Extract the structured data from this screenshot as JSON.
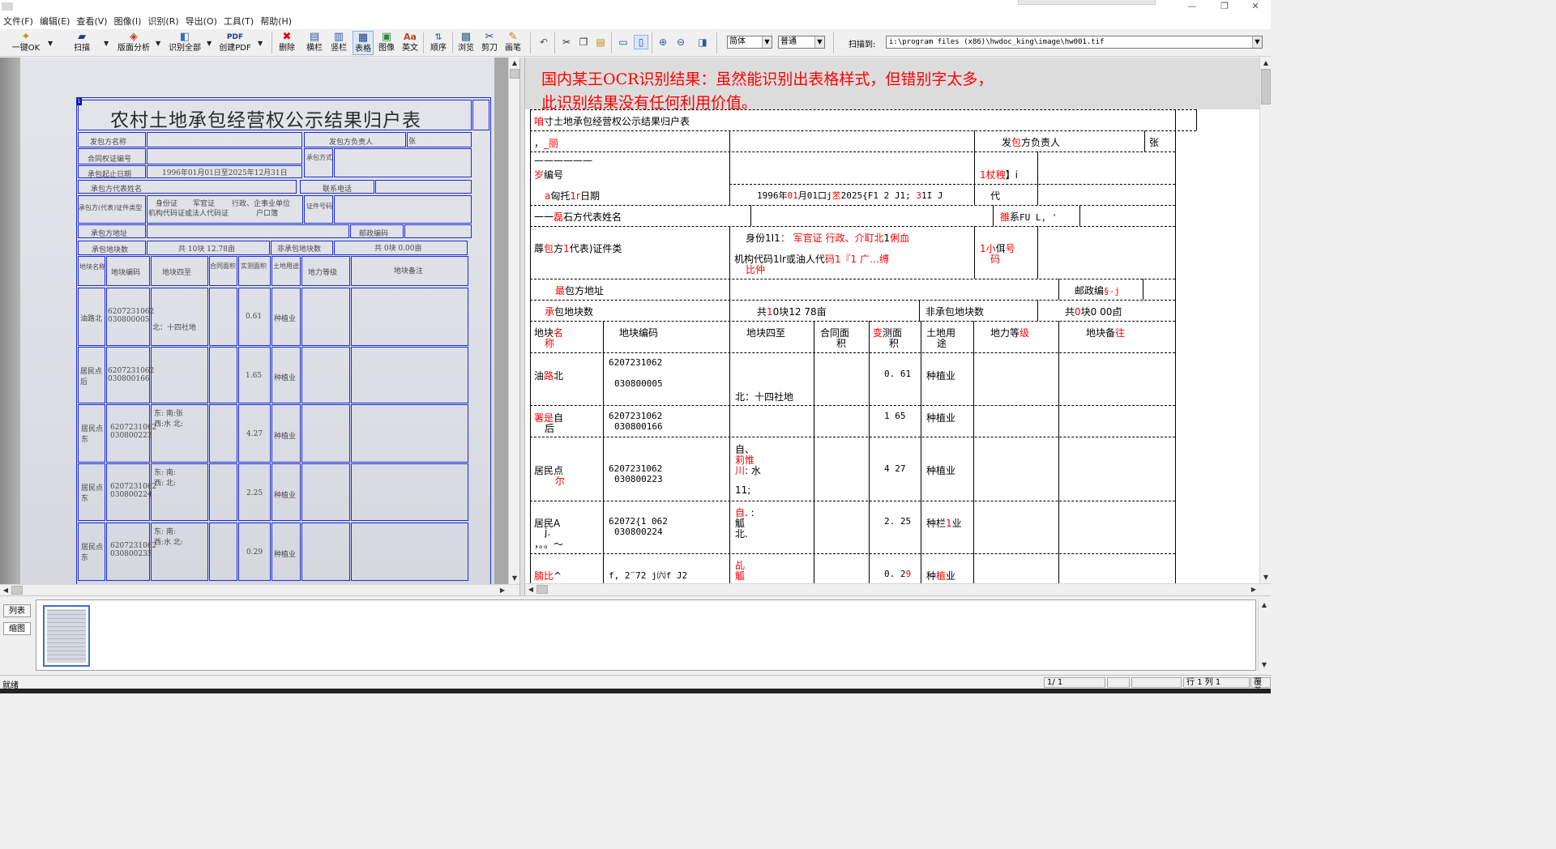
{
  "window": {
    "restore_glyph": "❐",
    "close_glyph": "✕",
    "minimize_glyph": "—"
  },
  "menu": [
    "文件(F)",
    "编辑(E)",
    "查看(V)",
    "图像(I)",
    "识别(R)",
    "导出(O)",
    "工具(T)",
    "帮助(H)"
  ],
  "toolbar": {
    "ok": "一键OK",
    "scan": "扫描",
    "layout": "版面分析",
    "recognize_all": "识别全部",
    "create_pdf": "创建PDF",
    "delete": "删除",
    "hbar": "横栏",
    "vbar": "竖栏",
    "table": "表格",
    "image": "图像",
    "english": "英文",
    "order": "顺序",
    "browse": "浏览",
    "cut": "剪刀",
    "pen": "画笔",
    "lang_value": "简体",
    "mode_value": "普通",
    "scan_to_label": "扫描到:",
    "scan_path": "i:\\program files (x86)\\hwdoc_king\\image\\hw001.tif"
  },
  "document_image": {
    "title": "农村土地承包经营权公示结果归户表",
    "rows": [
      [
        "发包方名称",
        "发包方负责人",
        "张"
      ],
      [
        "合同权证编号",
        "承包方式"
      ],
      [
        "承包起止日期",
        "1996年01月01日至2025年12月31日"
      ],
      [
        "承包方代表姓名",
        "联系电话"
      ],
      [
        "承包方(代表)证件类型",
        "身份证",
        "军官证",
        "行政、企事业单位",
        "机构代码证或法人代码证",
        "户口簿",
        "证件号码"
      ],
      [
        "承包方地址",
        "邮政编码"
      ],
      [
        "承包地块数",
        "共 10块 12.78亩",
        "非承包地块数",
        "共 0块 0.00亩"
      ]
    ],
    "headers": [
      "地块名称",
      "地块编码",
      "地块四至",
      "合同面积",
      "实测面积",
      "土地用途",
      "地力等级",
      "地块备注"
    ],
    "parcels": [
      [
        "油路北",
        "6207231062 030800005",
        "北：十四社地",
        "0.61",
        "种植业"
      ],
      [
        "居民点后",
        "6207231062 030800166",
        "",
        "1.65",
        "种植业"
      ],
      [
        "居民点东",
        "6207231062 030800223",
        "东: 南:张 西:水 北:",
        "4.27",
        "种植业"
      ],
      [
        "居民点东",
        "6207231062 030800224",
        "东: 南: 西: 北:",
        "2.25",
        "种植业"
      ],
      [
        "居民点东",
        "6207231062 030800235",
        "东: 南: 西:水 北:",
        "0.29",
        "种植业"
      ]
    ]
  },
  "ocr_result": {
    "note_line1": "国内某王OCR识别结果：虽然能识别出表格样式，但错别字太多，",
    "note_line2": "此识别结果没有任何利用价值。",
    "title_red": "咱",
    "title_rest": "寸土地承包经营权公示结果归户表",
    "r1a_b": "，",
    "r1a_r": "_丽",
    "r1b_b": "发",
    "r1b_r": "包",
    "r1b_c": "方负责人",
    "r1c": "张",
    "r2a_b": "——————",
    "r2b_r": "岁",
    "r2b_b": "编号",
    "r2c_r": "1杖䄿",
    "r2c_b": "】i",
    "r3a_r": "a",
    "r3a_b1": "匈托",
    "r3a_r2": "1r",
    "r3a_b2": "日期",
    "r3b_1": "1996年",
    "r3b_2": "01",
    "r3b_3": "月01口j",
    "r3b_4": "苤",
    "r3b_5": "2025{F1 2 J1; ",
    "r3b_6": "3",
    "r3b_7": "1I J",
    "r3c": "代",
    "r4a_b": "一一",
    "r4a_r": "磊",
    "r4a_c": "石方代表姓名",
    "r4b_r": "雒",
    "r4b_b": "系",
    "r4b_c": "FU L,  '",
    "r5a_b1": "蓐",
    "r5a_r": "包",
    "r5a_b2": "方",
    "r5a_r2": "1",
    "r5a_b3": "代表)证件类",
    "r5b_1": "身份1I1",
    "r5b_r1": "：  军官证  行政、介耵北",
    "r5b_2": "1",
    "r5b_r2": "俐血",
    "r5c_1": "机构代码1lr或油人代",
    "r5c_r1": "码1『1   广…缚",
    "r5d_r": "比仲",
    "r5e_r1": "1小",
    "r5e_b": "佴",
    "r5e_r2": "号",
    "r5f_r": "码",
    "r6a_r": "最",
    "r6a_b": "包方地址",
    "r6b_b": "邮政编",
    "r6b_r": "§-j",
    "r7a_r": "承",
    "r7a_b": "包地块数",
    "r7b_1": "共",
    "r7b_r": "1",
    "r7b_2": "0块12 78亩",
    "r7c": "非承包地块数",
    "r7d_1": "共",
    "r7d_r": "0",
    "r7d_2": "块0 00卣",
    "h1_b": "地块",
    "h1_r": "名",
    "h1_r2": "称",
    "h2": "地块编码",
    "h3": "地块四至",
    "h4a": "合同面",
    "h4b": "积",
    "h5_r": "变",
    "h5_b": "测面",
    "h5_b2": "积",
    "h6a": "土地用",
    "h6b": "途",
    "h7_b": "地力等",
    "h7_r": "级",
    "h8_b": "地块备",
    "h8_r": "往",
    "p1a_b": "油",
    "p1a_r": "路",
    "p1a_b2": "北",
    "p1b1": "6207231062",
    "p1b2": "030800005",
    "p1c": "北：十四社地",
    "p1d": "0. 61",
    "p1e": "种植业",
    "p2a_r": "署是",
    "p2a_b": "自",
    "p2a_b2": "后",
    "p2b1": "6207231062",
    "p2b2": "030800166",
    "p2d": "1 65",
    "p2e": "种植业",
    "p3a": "居民点",
    "p3a_r": "尔",
    "p3b1": "6207231062",
    "p3b2": "030800223",
    "p3c1": "自、",
    "p3c2_r": "莉惟",
    "p3c3_r": "川",
    "p3c3_b": ": 水",
    "p3c4": "11;",
    "p3d": "4 27",
    "p3e": "种植业",
    "p4a1": "居民A",
    "p4a2": "j.",
    "p4a3": "，。。～",
    "p4b1": "62072{1 062",
    "p4b2": "030800224",
    "p4c1_r": "自",
    "p4c1_b": ". :",
    "p4c2": "觚",
    "p4c3": "北.",
    "p4d": "2. 25",
    "p4e_b": "种栏",
    "p4e_r": "1",
    "p4e_b2": "业",
    "p5a_r": "腩比",
    "p5a_b": "^",
    "p5b": "f, 2¨72 j㈥f J2",
    "p5c_r": "乩",
    "p5c_r2": "觚",
    "p5d_b": "0. 2",
    "p5d_r": "9",
    "p5e_b": "种",
    "p5e_r": "植",
    "p5e_b2": "业"
  },
  "bottom": {
    "tab_list": "列表",
    "tab_thumb": "缩图"
  },
  "status": {
    "ready": "就绪",
    "page": "1/ 1",
    "line_label": "行",
    "col_label": "1 列",
    "col_value": "1",
    "overwrite": "覆盖"
  }
}
